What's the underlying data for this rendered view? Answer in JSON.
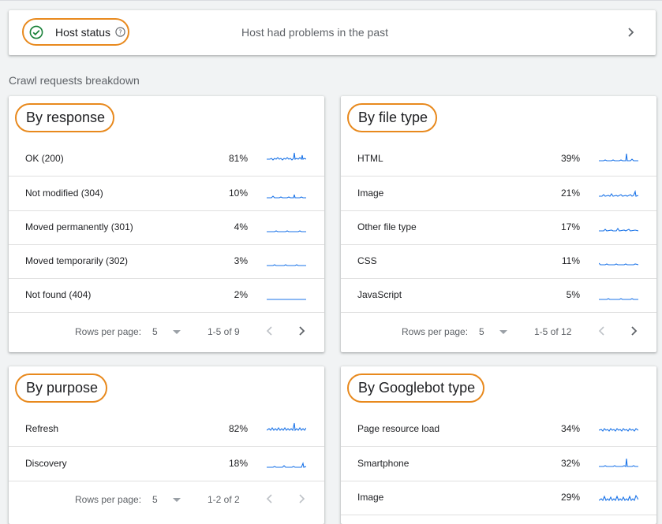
{
  "host": {
    "title": "Host status",
    "status_text": "Host had problems in the past"
  },
  "section_label": "Crawl requests breakdown",
  "colors": {
    "accent": "#1a73e8",
    "highlight": "#e8891d",
    "success": "#188038"
  },
  "cards": {
    "response": {
      "title": "By response",
      "rows": [
        {
          "label": "OK (200)",
          "pct": "81%"
        },
        {
          "label": "Not modified (304)",
          "pct": "10%"
        },
        {
          "label": "Moved permanently (301)",
          "pct": "4%"
        },
        {
          "label": "Moved temporarily (302)",
          "pct": "3%"
        },
        {
          "label": "Not found (404)",
          "pct": "2%"
        }
      ],
      "pager": {
        "label": "Rows per page:",
        "per_page": "5",
        "range": "1-5 of 9"
      }
    },
    "filetype": {
      "title": "By file type",
      "rows": [
        {
          "label": "HTML",
          "pct": "39%"
        },
        {
          "label": "Image",
          "pct": "21%"
        },
        {
          "label": "Other file type",
          "pct": "17%"
        },
        {
          "label": "CSS",
          "pct": "11%"
        },
        {
          "label": "JavaScript",
          "pct": "5%"
        }
      ],
      "pager": {
        "label": "Rows per page:",
        "per_page": "5",
        "range": "1-5 of 12"
      }
    },
    "purpose": {
      "title": "By purpose",
      "rows": [
        {
          "label": "Refresh",
          "pct": "82%"
        },
        {
          "label": "Discovery",
          "pct": "18%"
        }
      ],
      "pager": {
        "label": "Rows per page:",
        "per_page": "5",
        "range": "1-2 of 2"
      }
    },
    "googlebot": {
      "title": "By Googlebot type",
      "rows": [
        {
          "label": "Page resource load",
          "pct": "34%"
        },
        {
          "label": "Smartphone",
          "pct": "32%"
        },
        {
          "label": "Image",
          "pct": "29%"
        }
      ]
    }
  }
}
